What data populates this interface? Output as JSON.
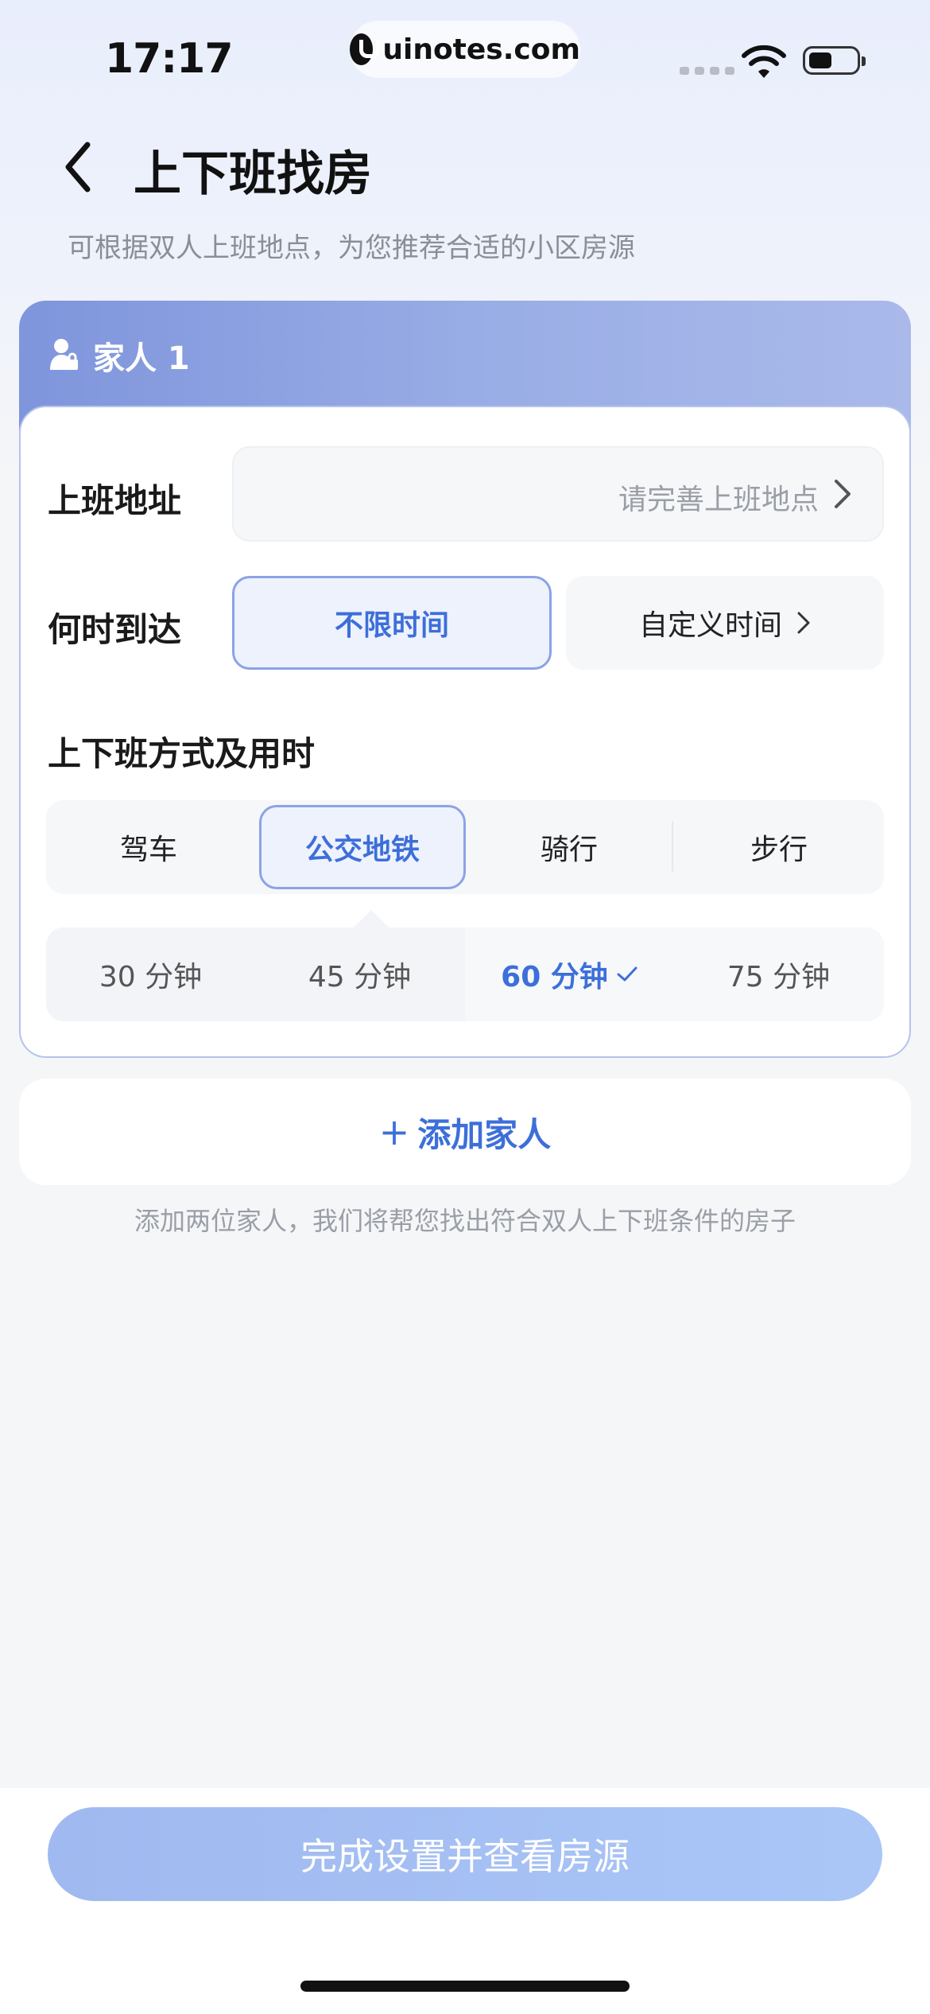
{
  "status": {
    "time": "17:17",
    "url": "uinotes.com"
  },
  "header": {
    "title": "上下班找房",
    "subtitle": "可根据双人上班地点，为您推荐合适的小区房源"
  },
  "member": {
    "title": "家人 1",
    "address_label": "上班地址",
    "address_placeholder": "请完善上班地点",
    "arrival_label": "何时到达",
    "arrival_options": [
      "不限时间",
      "自定义时间"
    ],
    "commute_label": "上下班方式及用时",
    "modes": [
      "驾车",
      "公交地铁",
      "骑行",
      "步行"
    ],
    "selected_mode": "公交地铁",
    "durations": [
      "30 分钟",
      "45 分钟",
      "60 分钟",
      "75 分钟"
    ],
    "selected_duration": "60 分钟"
  },
  "add_family": {
    "label": "添加家人",
    "hint": "添加两位家人，我们将帮您找出符合双人上下班条件的房子"
  },
  "footer": {
    "submit_label": "完成设置并查看房源"
  },
  "colors": {
    "accent": "#3d6fd9",
    "header_gradient_start": "#7f95dc",
    "button_gradient": "#a0b9f0"
  }
}
